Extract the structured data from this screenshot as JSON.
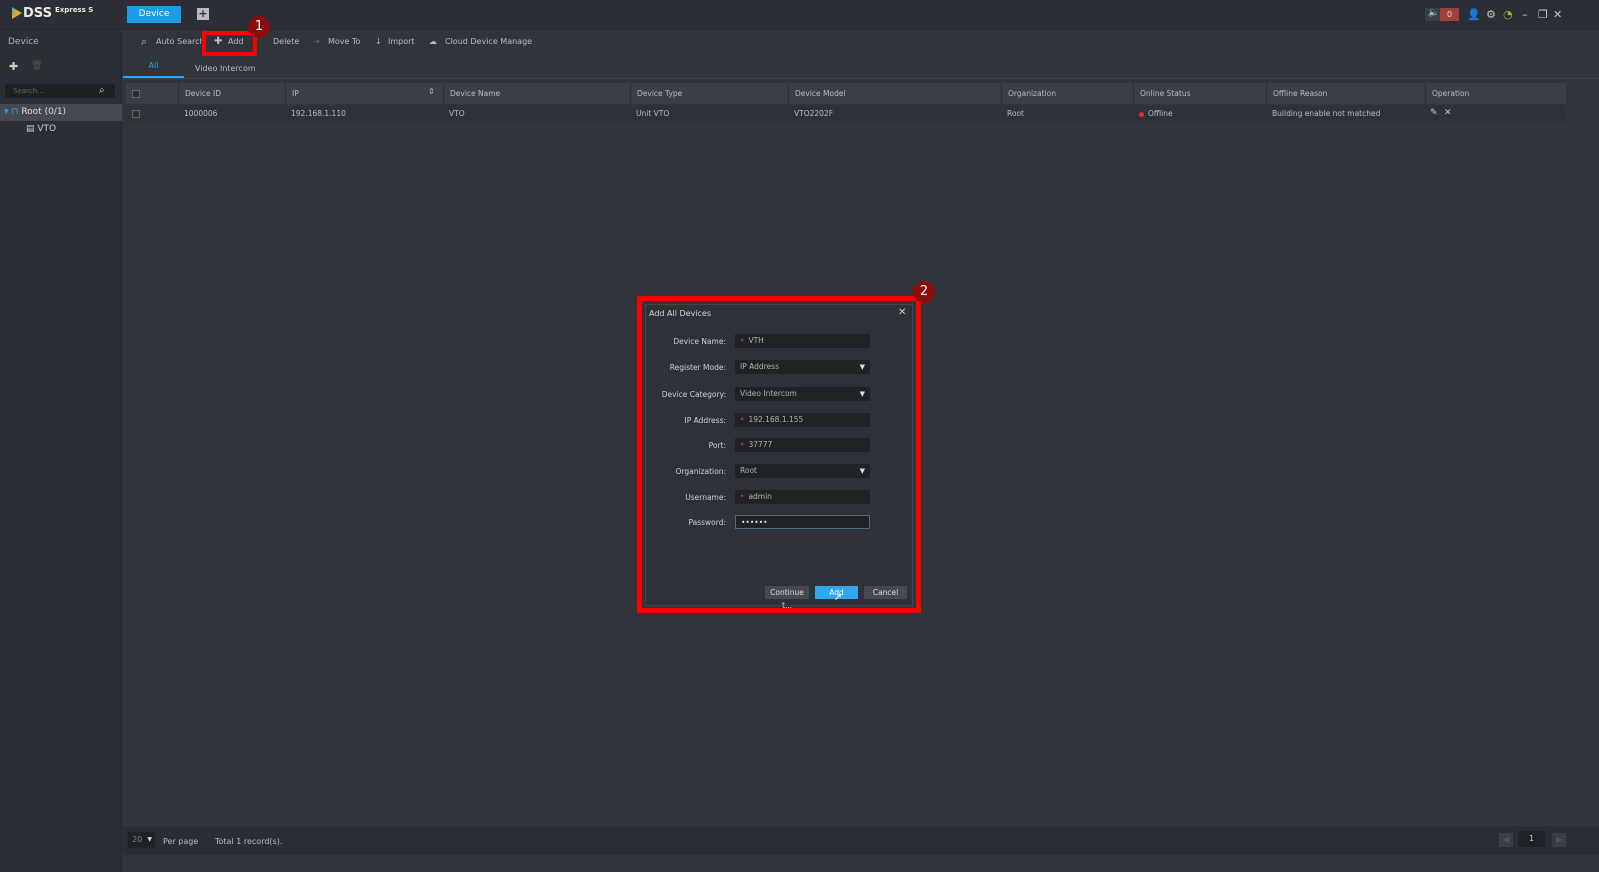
{
  "app": {
    "logo": "DSS",
    "logo_suffix": "Express S",
    "active_tab": "Device",
    "alarm_count": "0"
  },
  "sidebar": {
    "title": "Device",
    "search_placeholder": "Search...",
    "tree": [
      {
        "label": "Root (0/1)"
      },
      {
        "label": "VTO"
      }
    ]
  },
  "toolbar": {
    "auto_search": "Auto Search",
    "add": "Add",
    "delete": "Delete",
    "move_to": "Move To",
    "import": "Import",
    "cloud": "Cloud Device Manage"
  },
  "tabs": [
    "All",
    "Video Intercom"
  ],
  "table": {
    "columns": [
      "Device ID",
      "IP",
      "Device Name",
      "Device Type",
      "Device Model",
      "Organization",
      "Online Status",
      "Offline Reason",
      "Operation"
    ],
    "rows": [
      {
        "device_id": "1000006",
        "ip": "192.168.1.110",
        "name": "VTO",
        "type": "Unit VTO",
        "model": "VTO2202F",
        "org": "Root",
        "status": "Offline",
        "reason": "Building enable not matched"
      }
    ]
  },
  "footer": {
    "per_page_value": "20",
    "per_page": "Per page",
    "total": "Total 1 record(s).",
    "page": "1"
  },
  "annotations": [
    "1",
    "2"
  ],
  "dialog": {
    "title": "Add All Devices",
    "fields": [
      {
        "label": "Device Name:",
        "value": "VTH"
      },
      {
        "label": "Register Mode:",
        "value": "IP Address"
      },
      {
        "label": "Device Category:",
        "value": "Video Intercom"
      },
      {
        "label": "IP Address:",
        "value": "192.168.1.155"
      },
      {
        "label": "Port:",
        "value": "37777"
      },
      {
        "label": "Organization:",
        "value": "Root"
      },
      {
        "label": "Username:",
        "value": "admin"
      },
      {
        "label": "Password:",
        "value": "••••••"
      }
    ],
    "continue": "Continue t...",
    "add": "Add",
    "cancel": "Cancel"
  },
  "colors": {
    "accent": "#1e9be8",
    "highlight": "#ff0000",
    "offline": "#e03030"
  }
}
